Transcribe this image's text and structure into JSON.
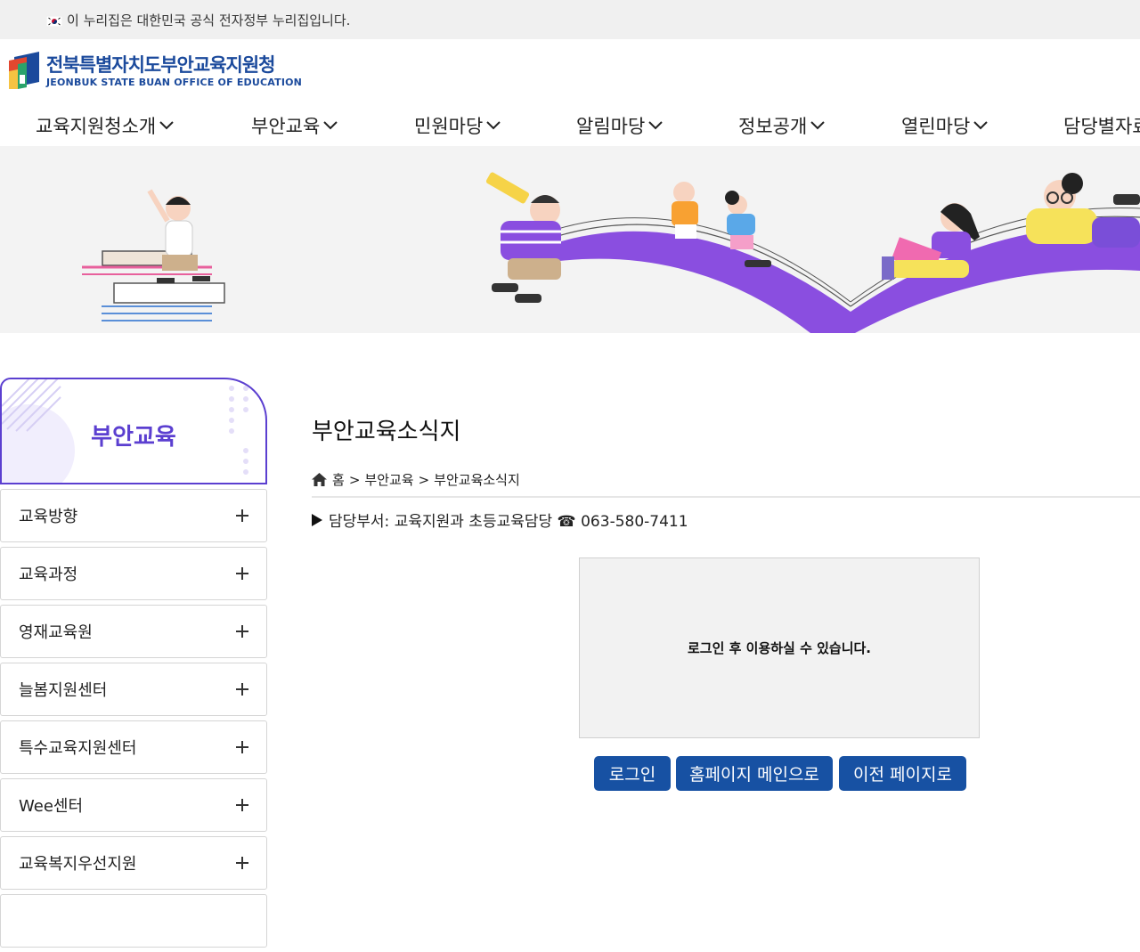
{
  "gov_banner": {
    "text": "이 누리집은 대한민국 공식 전자정부 누리집입니다."
  },
  "logo": {
    "name_ko": "전북특별자치도부안교육지원청",
    "name_en": "JEONBUK STATE BUAN OFFICE OF EDUCATION"
  },
  "gnb": [
    {
      "label": "교육지원청소개"
    },
    {
      "label": "부안교육"
    },
    {
      "label": "민원마당"
    },
    {
      "label": "알림마당"
    },
    {
      "label": "정보공개"
    },
    {
      "label": "열린마당"
    },
    {
      "label": "담당별자료"
    }
  ],
  "sidebar": {
    "title": "부안교육",
    "items": [
      {
        "label": "교육방향"
      },
      {
        "label": "교육과정"
      },
      {
        "label": "영재교육원"
      },
      {
        "label": "늘봄지원센터"
      },
      {
        "label": "특수교육지원센터"
      },
      {
        "label": "Wee센터"
      },
      {
        "label": "교육복지우선지원"
      },
      {
        "label": ""
      }
    ]
  },
  "content": {
    "title": "부안교육소식지",
    "breadcrumb": {
      "home": "홈",
      "sep1": ">",
      "level1": "부안교육",
      "sep2": ">",
      "level2": "부안교육소식지"
    },
    "dept": "담당부서: 교육지원과 초등교육담당 ☎ 063-580-7411",
    "login_message": "로그인 후 이용하실 수 있습니다.",
    "buttons": {
      "login": "로그인",
      "home": "홈페이지 메인으로",
      "back": "이전 페이지로"
    }
  },
  "colors": {
    "brand_blue": "#1751a3",
    "accent_purple": "#5b3fd0",
    "hero_purple": "#8a4ee0"
  }
}
